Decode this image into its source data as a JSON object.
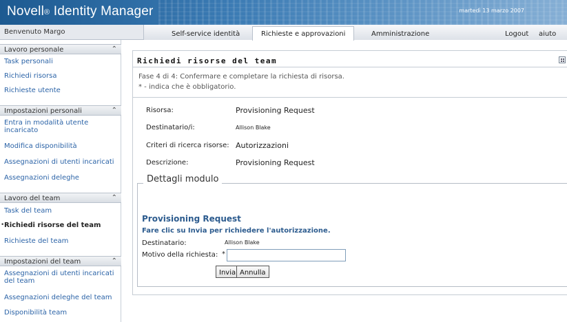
{
  "header": {
    "app_title": "Novell",
    "registered_mark": "®",
    "app_subtitle": " Identity Manager",
    "date": "martedì 13 marzo 2007"
  },
  "nav": {
    "welcome": "Benvenuto Margo",
    "tabs": [
      {
        "label": "Self-service identità"
      },
      {
        "label": "Richieste e approvazioni"
      },
      {
        "label": "Amministrazione"
      }
    ],
    "logout": "Logout",
    "help": "aiuto"
  },
  "sidebar": {
    "groups": [
      {
        "title": "Lavoro personale",
        "icon": "chevron-up-double-icon",
        "items": [
          "Task personali",
          "Richiedi risorsa",
          "Richieste utente"
        ]
      },
      {
        "title": "Impostazioni personali",
        "icon": "chevron-up-double-icon",
        "items": [
          "Entra in modalità utente incaricato",
          "Modifica disponibilità",
          "Assegnazioni di utenti incaricati",
          "Assegnazioni deleghe"
        ]
      },
      {
        "title": "Lavoro del team",
        "icon": "chevron-up-double-icon",
        "items": [
          "Task del team",
          "Richiedi risorse del team",
          "Richieste del team"
        ]
      },
      {
        "title": "Impostazioni del team",
        "icon": "chevron-up-double-icon",
        "items": [
          "Assegnazioni di utenti incaricati del team",
          "Assegnazioni deleghe del team",
          "Disponibilità team"
        ]
      }
    ]
  },
  "main": {
    "title": "Richiedi risorse del team",
    "step": "Fase 4 di 4: Confermare e completare la richiesta di risorsa.",
    "required_note": "* - indica che è obbligatorio.",
    "fields": [
      {
        "label": "Risorsa:",
        "value": "Provisioning Request"
      },
      {
        "label": "Destinatario/i:",
        "value": "Allison Blake"
      },
      {
        "label": "Criteri di ricerca risorse:",
        "value": "Autorizzazioni"
      },
      {
        "label": "Descrizione:",
        "value": "Provisioning Request"
      }
    ],
    "form_details_legend": "Dettagli modulo",
    "form": {
      "title": "Provisioning Request",
      "instructions": "Fare clic su Invia per richiedere l'autorizzazione.",
      "recipient_label": "Destinatario:",
      "recipient_value": "Allison Blake",
      "reason_label": "Motivo della richiesta:",
      "required_mark": "*",
      "reason_value": "",
      "submit_label": "Invia",
      "cancel_label": "Annulla"
    }
  },
  "colors": {
    "banner": "#3a7ab3",
    "link": "#2b63a7",
    "form_title": "#2c5b8e"
  }
}
